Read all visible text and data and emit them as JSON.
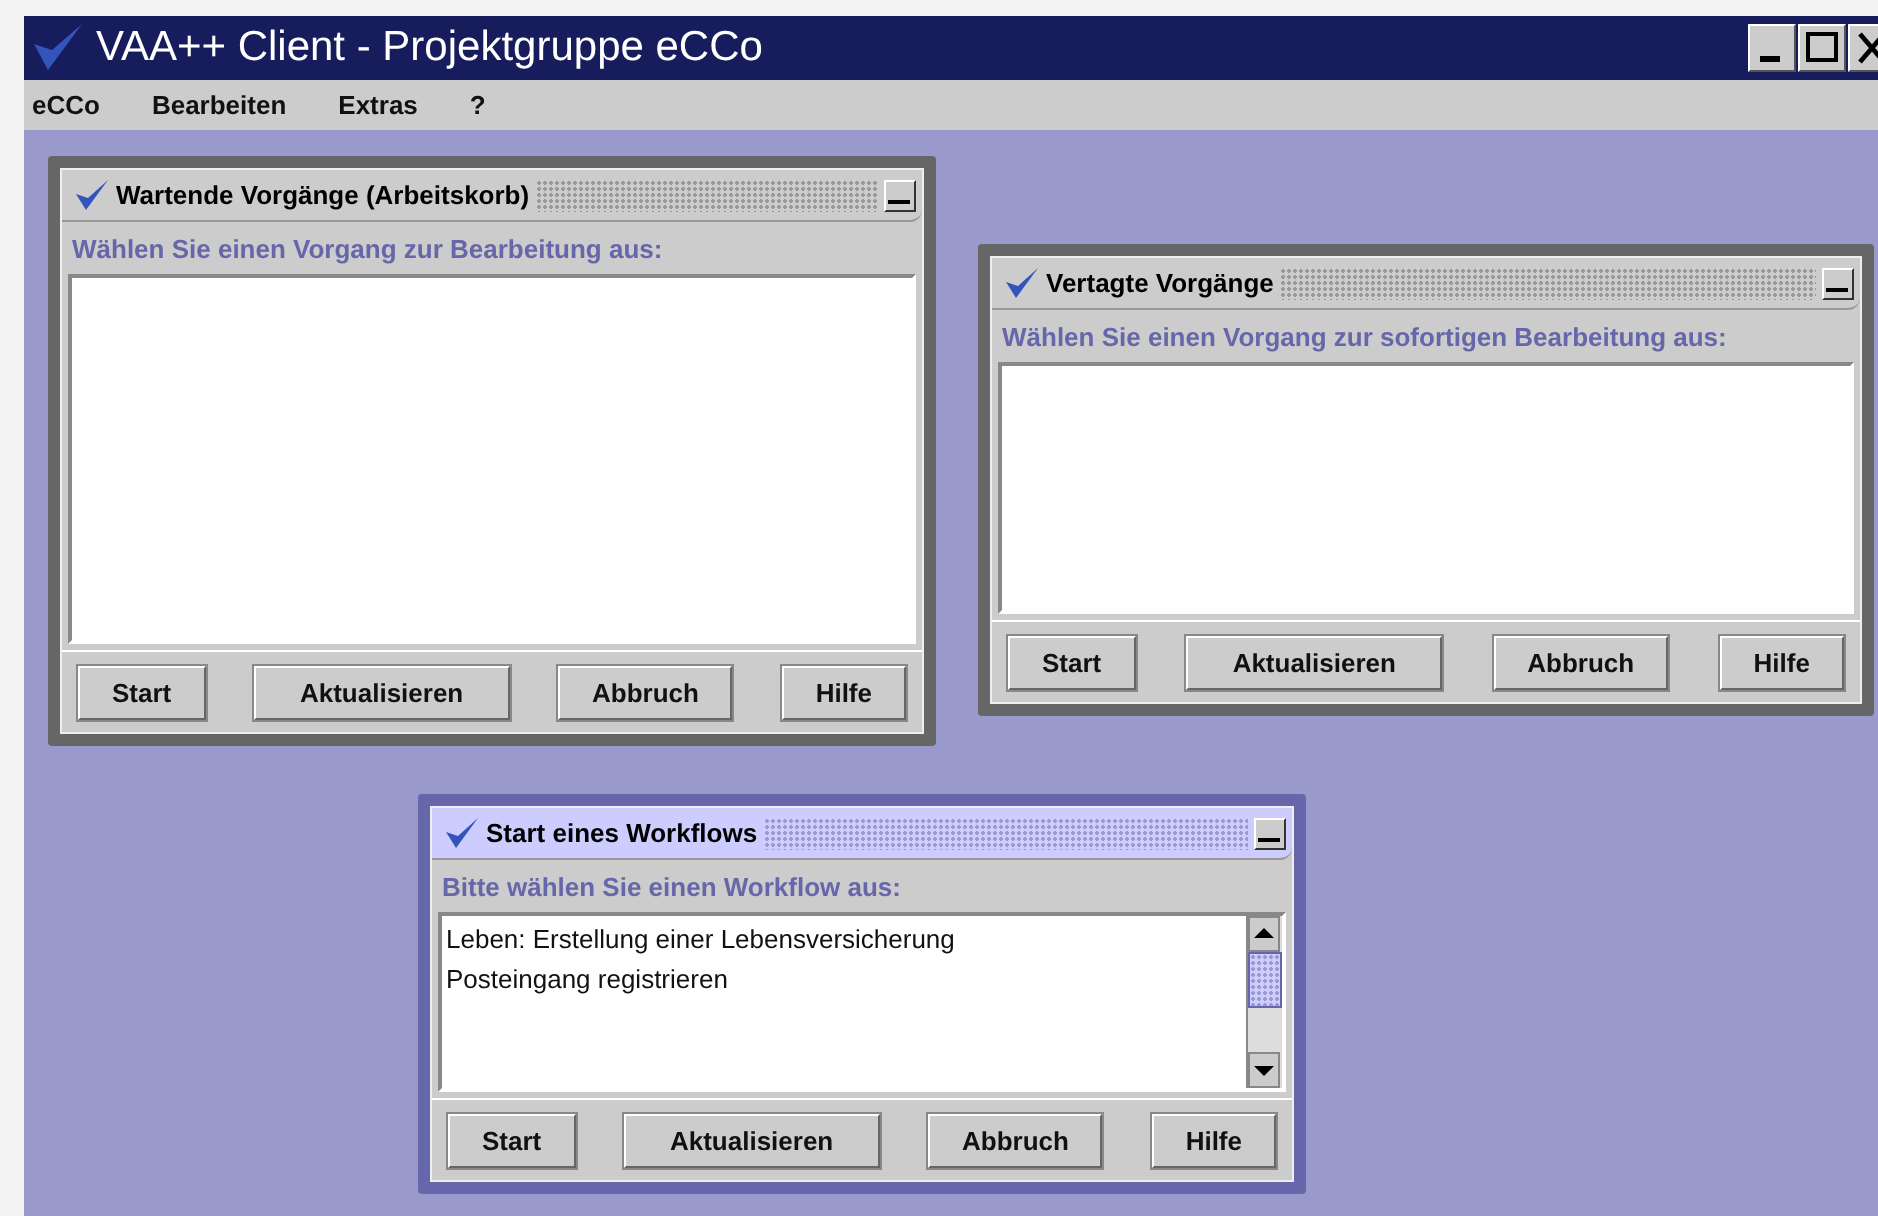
{
  "window": {
    "title": "VAA++ Client - Projektgruppe eCCo"
  },
  "menu": [
    {
      "label": "eCCo"
    },
    {
      "label": "Bearbeiten"
    },
    {
      "label": "Extras"
    },
    {
      "label": "?"
    }
  ],
  "frames": [
    {
      "title": "Wartende Vorgänge (Arbeitskorb)",
      "active": false,
      "prompt": "Wählen Sie einen Vorgang zur Bearbeitung aus:",
      "buttons": [
        "Start",
        "Aktualisieren",
        "Abbruch",
        "Hilfe"
      ]
    },
    {
      "title": "Vertagte Vorgänge",
      "active": false,
      "prompt": "Wählen Sie einen Vorgang zur sofortigen Bearbeitung aus:",
      "buttons": [
        "Start",
        "Aktualisieren",
        "Abbruch",
        "Hilfe"
      ]
    },
    {
      "title": "Start eines Workflows",
      "active": true,
      "prompt": "Bitte wählen Sie einen Workflow aus:",
      "items": [
        "Leben: Erstellung einer Lebensversicherung",
        "Posteingang registrieren"
      ],
      "scrollbar": true,
      "buttons": [
        "Start",
        "Aktualisieren",
        "Abbruch",
        "Hilfe"
      ]
    }
  ]
}
